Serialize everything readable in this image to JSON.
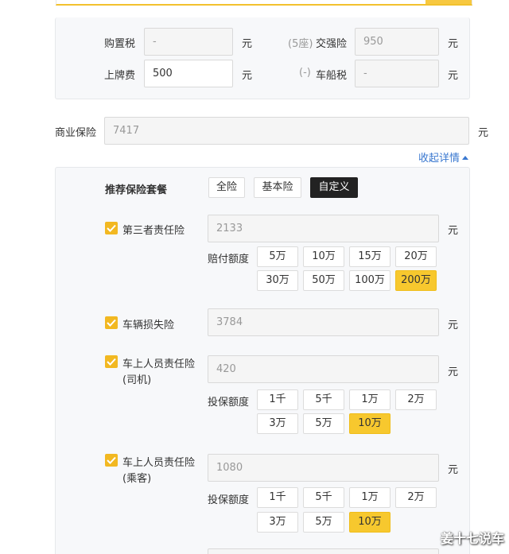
{
  "unit": "元",
  "tax_panel": {
    "purchase_tax_label": "购置税",
    "purchase_tax_value": "-",
    "compulsory_prefix": "(5座)",
    "compulsory_label": "交强险",
    "compulsory_value": "950",
    "plate_fee_label": "上牌费",
    "plate_fee_value": "500",
    "vessel_prefix": "(-)",
    "vessel_tax_label": "车船税",
    "vessel_tax_value": "-"
  },
  "commercial": {
    "label": "商业保险",
    "value": "7417",
    "collapse_link": "收起详情"
  },
  "packages": {
    "label": "推荐保险套餐",
    "options": [
      "全险",
      "基本险",
      "自定义"
    ],
    "selected": "自定义"
  },
  "third_party": {
    "label": "第三者责任险",
    "value": "2133",
    "amount_label": "赔付额度",
    "amounts": [
      "5万",
      "10万",
      "15万",
      "20万",
      "30万",
      "50万",
      "100万",
      "200万"
    ],
    "selected": "200万"
  },
  "vehicle_loss": {
    "label": "车辆损失险",
    "value": "3784"
  },
  "driver": {
    "label_line1": "车上人员责任险",
    "label_line2": "(司机)",
    "value": "420",
    "amount_label": "投保额度",
    "amounts": [
      "1千",
      "5千",
      "1万",
      "2万",
      "3万",
      "5万",
      "10万"
    ],
    "selected": "10万"
  },
  "passenger": {
    "label_line1": "车上人员责任险",
    "label_line2": "(乘客)",
    "value": "1080",
    "amount_label": "投保额度",
    "amounts": [
      "1千",
      "5千",
      "1万",
      "2万",
      "3万",
      "5万",
      "10万"
    ],
    "selected": "10万"
  },
  "watermark": "姜十七说车",
  "colors": {
    "accent": "#f7c82e",
    "link": "#3a78d0",
    "dark_button": "#222222"
  }
}
